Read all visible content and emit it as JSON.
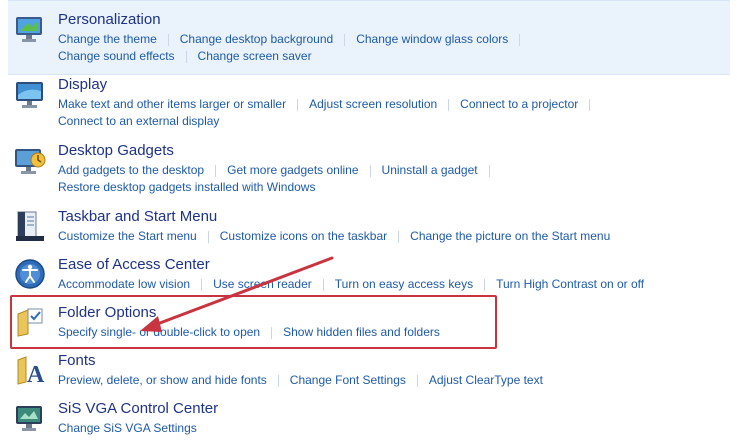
{
  "categories": [
    {
      "title": "Personalization",
      "icon": "monitor-paint-icon",
      "rows": [
        [
          "Change the theme",
          "Change desktop background",
          "Change window glass colors"
        ],
        [
          "Change sound effects",
          "Change screen saver"
        ]
      ]
    },
    {
      "title": "Display",
      "icon": "display-icon",
      "rows": [
        [
          "Make text and other items larger or smaller",
          "Adjust screen resolution",
          "Connect to a projector"
        ],
        [
          "Connect to an external display"
        ]
      ]
    },
    {
      "title": "Desktop Gadgets",
      "icon": "gadgets-icon",
      "rows": [
        [
          "Add gadgets to the desktop",
          "Get more gadgets online",
          "Uninstall a gadget"
        ],
        [
          "Restore desktop gadgets installed with Windows"
        ]
      ]
    },
    {
      "title": "Taskbar and Start Menu",
      "icon": "taskbar-icon",
      "rows": [
        [
          "Customize the Start menu",
          "Customize icons on the taskbar",
          "Change the picture on the Start menu"
        ]
      ]
    },
    {
      "title": "Ease of Access Center",
      "icon": "ease-of-access-icon",
      "rows": [
        [
          "Accommodate low vision",
          "Use screen reader",
          "Turn on easy access keys",
          "Turn High Contrast on or off"
        ]
      ]
    },
    {
      "title": "Folder Options",
      "icon": "folder-options-icon",
      "rows": [
        [
          "Specify single- or double-click to open",
          "Show hidden files and folders"
        ]
      ]
    },
    {
      "title": "Fonts",
      "icon": "fonts-icon",
      "rows": [
        [
          "Preview, delete, or show and hide fonts",
          "Change Font Settings",
          "Adjust ClearType text"
        ]
      ]
    },
    {
      "title": "SiS VGA Control Center",
      "icon": "sis-vga-icon",
      "rows": [
        [
          "Change SiS VGA Settings"
        ]
      ]
    }
  ],
  "colors": {
    "title": "#1e3287",
    "link": "#1e5aa8",
    "annotation": "#c8343f",
    "highlight": "#eaf3fc"
  }
}
